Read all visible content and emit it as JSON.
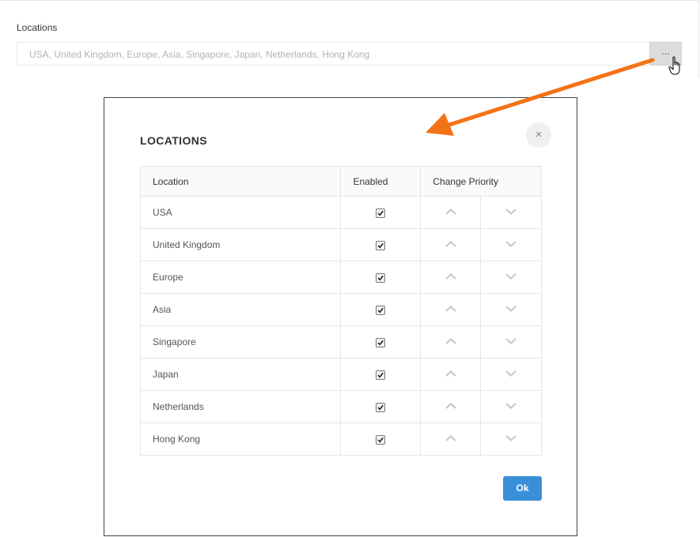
{
  "field": {
    "label": "Locations",
    "value": "USA, United Kingdom, Europe, Asia, Singapore, Japan, Netherlands, Hong Kong",
    "button_label": "..."
  },
  "modal": {
    "title": "LOCATIONS",
    "close_symbol": "×",
    "columns": {
      "location": "Location",
      "enabled": "Enabled",
      "priority": "Change Priority"
    },
    "rows": [
      {
        "name": "USA",
        "enabled": true
      },
      {
        "name": "United Kingdom",
        "enabled": true
      },
      {
        "name": "Europe",
        "enabled": true
      },
      {
        "name": "Asia",
        "enabled": true
      },
      {
        "name": "Singapore",
        "enabled": true
      },
      {
        "name": "Japan",
        "enabled": true
      },
      {
        "name": "Netherlands",
        "enabled": true
      },
      {
        "name": "Hong Kong",
        "enabled": true
      }
    ],
    "ok_label": "Ok"
  },
  "colors": {
    "accent": "#3b8fd9",
    "annotation_arrow": "#f47216",
    "chevron": "#c8c8c8"
  },
  "icons": {
    "up": "chevron-up-icon",
    "down": "chevron-down-icon",
    "cursor": "hand-pointer-icon",
    "close": "close-icon"
  }
}
